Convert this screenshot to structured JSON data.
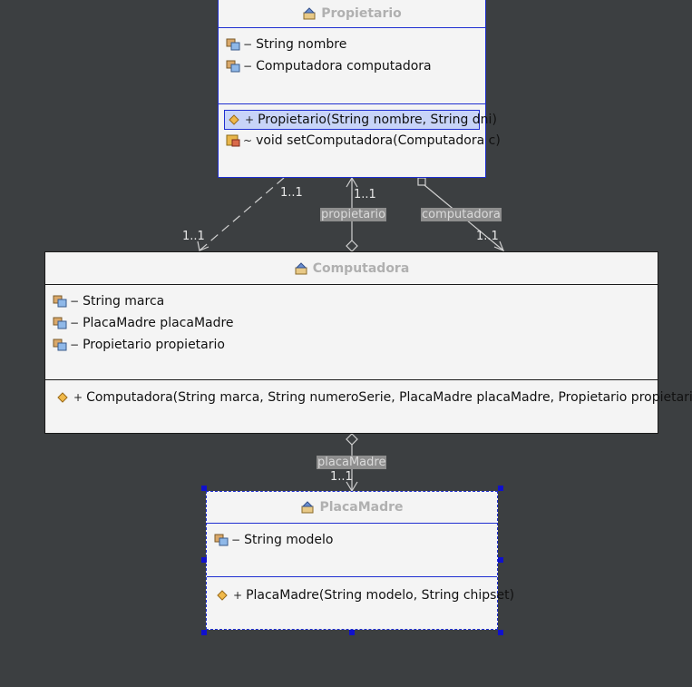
{
  "classes": {
    "propietario": {
      "name": "Propietario",
      "attributes": [
        {
          "vis": "−",
          "text": "String nombre"
        },
        {
          "vis": "−",
          "text": "Computadora computadora"
        }
      ],
      "methods": [
        {
          "vis": "+",
          "text": "Propietario(String nombre, String dni)"
        },
        {
          "vis": "~",
          "text": "void setComputadora(Computadora c)"
        }
      ]
    },
    "computadora": {
      "name": "Computadora",
      "attributes": [
        {
          "vis": "−",
          "text": "String marca"
        },
        {
          "vis": "−",
          "text": "PlacaMadre placaMadre"
        },
        {
          "vis": "−",
          "text": "Propietario propietario"
        }
      ],
      "methods": [
        {
          "vis": "+",
          "text": "Computadora(String marca, String numeroSerie, PlacaMadre placaMadre, Propietario propietario)"
        }
      ]
    },
    "placamadre": {
      "name": "PlacaMadre",
      "attributes": [
        {
          "vis": "−",
          "text": "String modelo"
        }
      ],
      "methods": [
        {
          "vis": "+",
          "text": "PlacaMadre(String modelo, String chipset)"
        }
      ]
    }
  },
  "relations": {
    "dependency": {
      "mult_source": "1..1",
      "mult_target": "1..1"
    },
    "propietario_assoc": {
      "role": "propietario",
      "mult": "1..1"
    },
    "computadora_assoc": {
      "role": "computadora",
      "mult": "1..1"
    },
    "placamadre_assoc": {
      "role": "placaMadre",
      "mult": "1..1"
    }
  },
  "colors": {
    "background": "#3c3f41",
    "selection": "#1f2fd1",
    "title_text": "#b0b0b0"
  }
}
